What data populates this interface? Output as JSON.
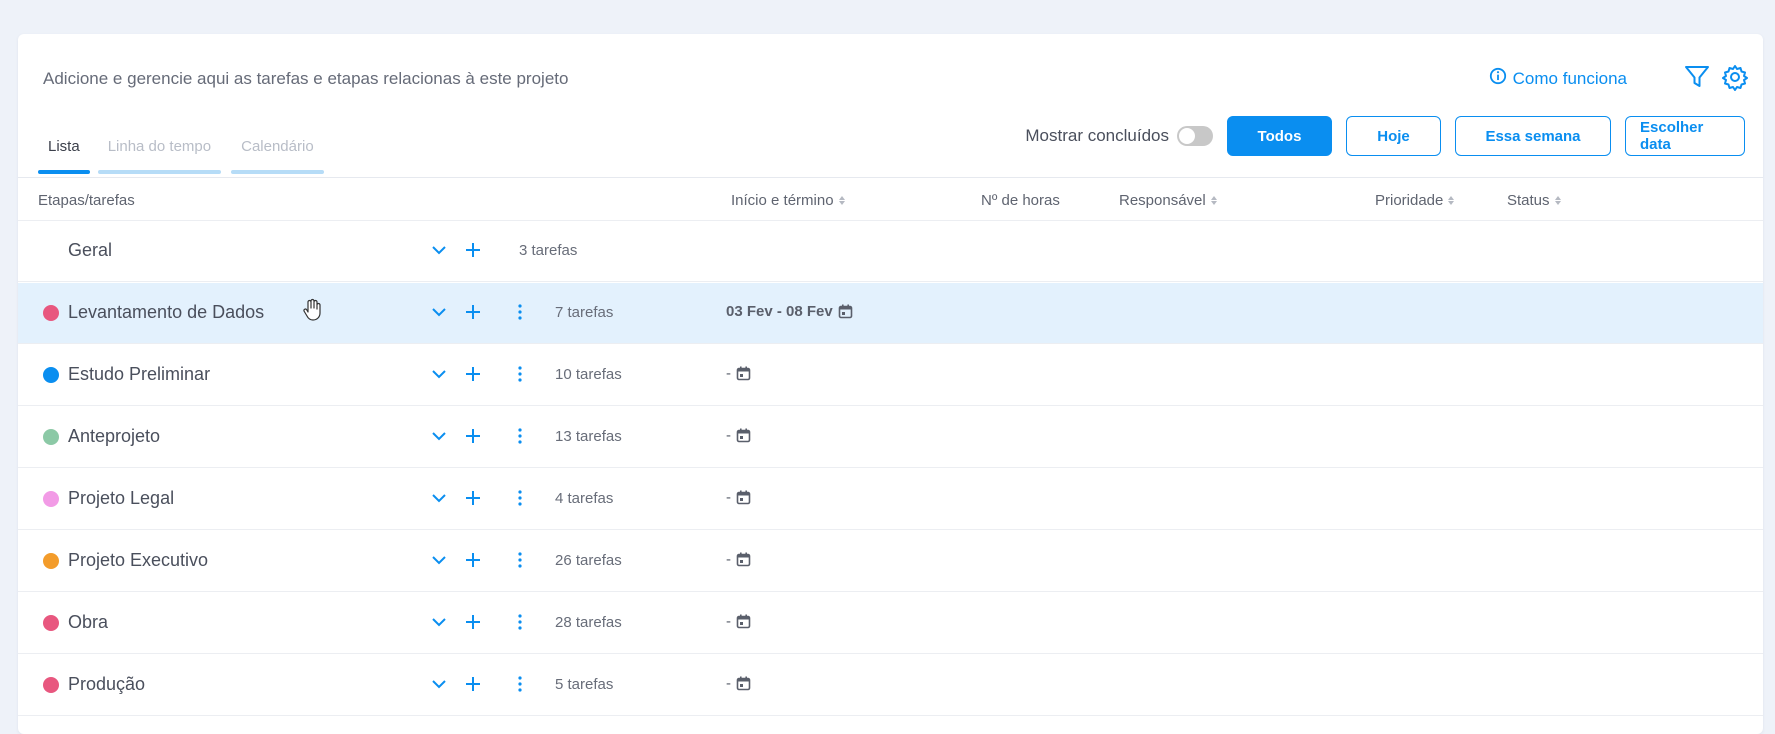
{
  "header": {
    "description": "Adicione e gerencie aqui as tarefas e etapas relacionas à este projeto",
    "how_it_works": "Como funciona"
  },
  "icons": {
    "info": "info-circle-icon",
    "filter": "filter-icon",
    "settings": "gear-icon"
  },
  "tabs": [
    {
      "label": "Lista",
      "active": true
    },
    {
      "label": "Linha do tempo",
      "active": false
    },
    {
      "label": "Calendário",
      "active": false
    }
  ],
  "controls": {
    "show_done_label": "Mostrar concluídos",
    "show_done_on": false,
    "filters": [
      {
        "label": "Todos",
        "active": true
      },
      {
        "label": "Hoje",
        "active": false
      },
      {
        "label": "Essa semana",
        "active": false
      },
      {
        "label": "Escolher data",
        "active": false
      }
    ]
  },
  "columns": {
    "stages": "Etapas/tarefas",
    "dates": "Início e término",
    "hours": "Nº de horas",
    "owner": "Responsável",
    "priority": "Prioridade",
    "status": "Status"
  },
  "general_row": {
    "name": "Geral",
    "count": "3 tarefas"
  },
  "stages": [
    {
      "name": "Levantamento de Dados",
      "color": "#e8577f",
      "count": "7 tarefas",
      "dates": "03 Fev - 08 Fev",
      "highlighted": true
    },
    {
      "name": "Estudo Preliminar",
      "color": "#0a8ef0",
      "count": "10 tarefas",
      "dates": "-",
      "highlighted": false
    },
    {
      "name": "Anteprojeto",
      "color": "#8cc9a6",
      "count": "13 tarefas",
      "dates": "-",
      "highlighted": false
    },
    {
      "name": "Projeto Legal",
      "color": "#f29be6",
      "count": "4 tarefas",
      "dates": "-",
      "highlighted": false
    },
    {
      "name": "Projeto Executivo",
      "color": "#f39c2b",
      "count": "26 tarefas",
      "dates": "-",
      "highlighted": false
    },
    {
      "name": "Obra",
      "color": "#e8577f",
      "count": "28 tarefas",
      "dates": "-",
      "highlighted": false
    },
    {
      "name": "Produção",
      "color": "#e8577f",
      "count": "5 tarefas",
      "dates": "-",
      "highlighted": false
    }
  ],
  "colors": {
    "accent": "#0a8ef0",
    "highlight_row": "#e3f1fd"
  }
}
